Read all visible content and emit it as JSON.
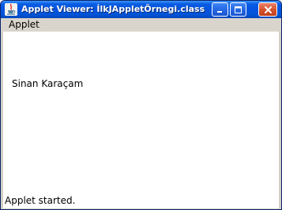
{
  "window": {
    "title": "Applet Viewer: İlkJAppletÖrnegi.class",
    "icon": "java-cup-icon",
    "buttons": {
      "minimize": "minimize-icon",
      "maximize": "maximize-icon",
      "close": "close-icon"
    }
  },
  "menubar": {
    "items": [
      {
        "label": "Applet"
      }
    ]
  },
  "applet": {
    "text": "Sinan Karaçam"
  },
  "statusbar": {
    "text": "Applet started."
  },
  "colors": {
    "titlebar": "#0554e3",
    "close_button": "#d4522c",
    "menubar": "#d9d5cd",
    "content": "#ffffff"
  }
}
